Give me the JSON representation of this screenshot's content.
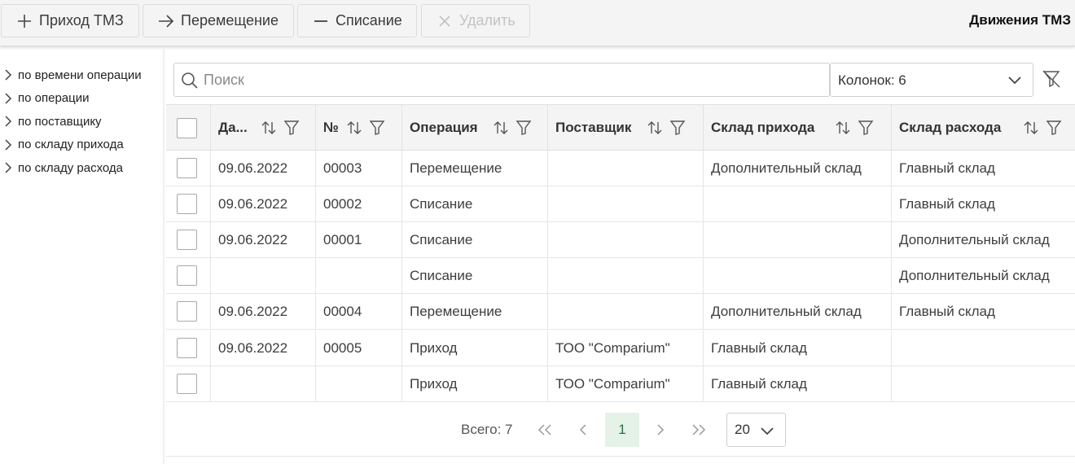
{
  "toolbar": {
    "add_label": "Приход ТМЗ",
    "move_label": "Перемещение",
    "writeoff_label": "Списание",
    "delete_label": "Удалить",
    "title": "Движения ТМЗ",
    "delete_disabled": true
  },
  "tree": {
    "items": [
      {
        "label": "по времени операции"
      },
      {
        "label": "по операции"
      },
      {
        "label": "по поставщику"
      },
      {
        "label": "по складу прихода"
      },
      {
        "label": "по складу расхода"
      }
    ]
  },
  "search": {
    "placeholder": "Поиск",
    "value": ""
  },
  "columns_select": {
    "value": "Колонок: 6"
  },
  "table": {
    "headers": [
      "Да...",
      "№",
      "Операция",
      "Поставщик",
      "Склад прихода",
      "Склад расхода"
    ],
    "rows": [
      [
        "09.06.2022",
        "00003",
        "Перемещение",
        "",
        "Дополнительный склад",
        "Главный склад"
      ],
      [
        "09.06.2022",
        "00002",
        "Списание",
        "",
        "",
        "Главный склад"
      ],
      [
        "09.06.2022",
        "00001",
        "Списание",
        "",
        "",
        "Дополнительный склад"
      ],
      [
        "",
        "",
        "Списание",
        "",
        "",
        "Дополнительный склад"
      ],
      [
        "09.06.2022",
        "00004",
        "Перемещение",
        "",
        "Дополнительный склад",
        "Главный склад"
      ],
      [
        "09.06.2022",
        "00005",
        "Приход",
        "ТОО \"Comparium\"",
        "Главный склад",
        ""
      ],
      [
        "",
        "",
        "Приход",
        "ТОО \"Comparium\"",
        "Главный склад",
        ""
      ]
    ]
  },
  "pagination": {
    "total": "Всего: 7",
    "current_page": "1",
    "page_size": "20"
  },
  "colors": {
    "toolbar_bg": "#f4f4f4",
    "header_bg": "#f4f4f4",
    "active_page_bg": "#e4f2e8",
    "border": "#e6e6e6"
  }
}
